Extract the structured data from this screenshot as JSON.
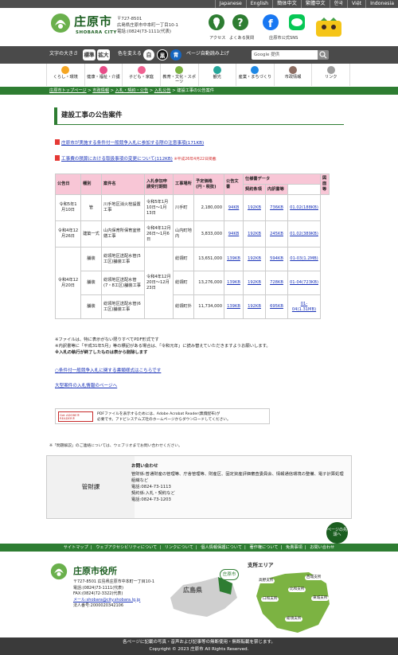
{
  "languages": [
    "Japanese",
    "English",
    "簡体中文",
    "繁體中文",
    "한국",
    "Việt",
    "Indonesia"
  ],
  "header": {
    "logo_text": "庄原市",
    "logo_sub": "SHOBARA CITY",
    "address_lines": [
      "〒727-8501",
      "広島県庄原市中本町一丁目10-1",
      "電話:(0824)73-1111(代表)"
    ],
    "access_label": "アクセス",
    "faq_label": "よくある質問",
    "sns_label": "庄原市公式SNS"
  },
  "toolbar": {
    "font_size_label": "文字の大きさ",
    "standard": "標準",
    "enlarge": "拡大",
    "color_label": "色を変える",
    "white": "白",
    "black": "黒",
    "blue": "青",
    "auto_read": "ページ自動読み上げ",
    "search_placeholder": "Google 提供"
  },
  "nav": [
    {
      "label": "くらし・環境",
      "color": "#f5a623"
    },
    {
      "label": "健康・福祉・介護",
      "color": "#e84c88"
    },
    {
      "label": "子ども・家庭",
      "color": "#f06292"
    },
    {
      "label": "教育・文化・スポーツ",
      "color": "#7cb342"
    },
    {
      "label": "観光",
      "color": "#26a69a"
    },
    {
      "label": "産業・まちづくり",
      "color": "#1e88e5"
    },
    {
      "label": "市政情報",
      "color": "#8d6e63"
    },
    {
      "label": "リンク",
      "color": "#9e9e9e"
    }
  ],
  "breadcrumb": [
    "庄原市トップページ",
    "市政情報",
    "入札・契約・公告",
    "入札公告",
    "建設工事の公告案件"
  ],
  "page_title": "建設工事の公告案件",
  "links": {
    "notice1": "庄原市が実施する条件付一般競争入札に参加する際の注意事項(171KB)",
    "notice2": "工事費の積算における取扱事項の変更について(112KB)",
    "notice2_note": "※平成26年4月22日掲載"
  },
  "table": {
    "headers": [
      "公告日",
      "種別",
      "案件名",
      "入札参加申請受付期間",
      "工事場所",
      "予定価格(円・税抜)",
      "公告文書",
      "仕様書データ",
      "契約条項",
      "内訳書等",
      "図面等"
    ],
    "rows": [
      {
        "date": "令和5年1月10日",
        "type": "管",
        "name": "川手地区消火栓設置工事",
        "period": "令和5年1月10日～1月13日",
        "place": "川手町",
        "price": "2,180,000",
        "doc": "94KB",
        "contract": "192KB",
        "detail": "736KB",
        "drawing": "01.02(188KB)"
      },
      {
        "date": "令和4年12月26日",
        "type": "建築一式",
        "name": "山内保育所保育室修繕工事",
        "period": "令和4年12月26日～1月6日",
        "place": "山内町地内",
        "price": "3,833,000",
        "doc": "94KB",
        "contract": "192KB",
        "detail": "245KB",
        "drawing": "01.02(389KB)"
      },
      {
        "date": "令和4年12月20日",
        "type": "舗装",
        "name": "総領地区送配水管(5工区)舗装工事",
        "period": "令和4年12月20日～12月23日",
        "place": "総領町",
        "price": "13,651,000",
        "doc": "139KB",
        "contract": "192KB",
        "detail": "594KB",
        "drawing": "01-03(1.2MB)"
      },
      {
        "date": "",
        "type": "舗装",
        "name": "総領地区送配水管(7・8工区)舗装工事",
        "period": "",
        "place": "総領町",
        "price": "13,276,000",
        "doc": "139KB",
        "contract": "192KB",
        "detail": "728KB",
        "drawing": "01-04(723KB)"
      },
      {
        "date": "",
        "type": "舗装",
        "name": "総領地区送配水管(6工区)舗装工事",
        "period": "",
        "place": "総領町外",
        "price": "11,734,000",
        "doc": "139KB",
        "contract": "192KB",
        "detail": "695KB",
        "drawing": "01-04(1.31MB)"
      }
    ]
  },
  "notes": [
    "※ファイルは、特に表示がない限りすべてPDF形式です",
    "※内訳書等に「平成31年5月」等の標記がある場合は、「令和元年」に読み替えていただきますようお願いします。",
    "※入札の執行が終了したものは表から削除します"
  ],
  "bottom_links": [
    "○条件付一般競争入札に関する書類様式はこちらです",
    "大型案件の入札情報のページへ"
  ],
  "acrobat": {
    "badge": "Get ADOBE® READER®",
    "text1": "PDFファイルを表示するためには、Adobe Acrobat Reader(無償配布)が",
    "text2": "必要です。アドビシステムズ社のホームページからダウンロードしてください。"
  },
  "enquiry_note": "※「問題解説」のご連絡については、ウェブリオまでお問い合わせください。",
  "contact": {
    "dept": "管財課",
    "heading": "お問い合わせ",
    "line1": "管財係:普通財産の管理等、庁舎管理等、財産区、固定資産評価審査委員会、情報通信環境の整備、電子計算処理組織など",
    "line2": "電話:0824-73-1113",
    "line3": "契約係:入札・契約など",
    "line4": "電話:0824-73-1203"
  },
  "pagetop": "ページの先頭へ",
  "footer_links": [
    "サイトマップ",
    "ウェブアクセシビリティについて",
    "リンクについて",
    "個人情報保護について",
    "著作権について",
    "免責事項",
    "お問い合わせ"
  ],
  "footer": {
    "city_office": "庄原市役所",
    "address": "〒727-8501 広島県庄原市中本町一丁目10-1",
    "tel": "電話:(0824)73-1111(代表)",
    "fax": "FAX:(0824)72-3322(代表)",
    "mail": "メール:shobara@city.shobara.lg.jp",
    "corp_no": "法人番号:2000020342106",
    "pref_label": "広島県",
    "city_label": "庄原市",
    "branch_area": "支所エリア",
    "branches": [
      "高野支所",
      "西城支所",
      "比和支所",
      "口和支所",
      "東城支所",
      "総領支所"
    ]
  },
  "copyright": {
    "line1": "各ページに記載の写真・音声および記事等の無断使用・無断転載を禁じます。",
    "line2": "Copyright © 2023 庄原市 All Rights Reserved."
  }
}
